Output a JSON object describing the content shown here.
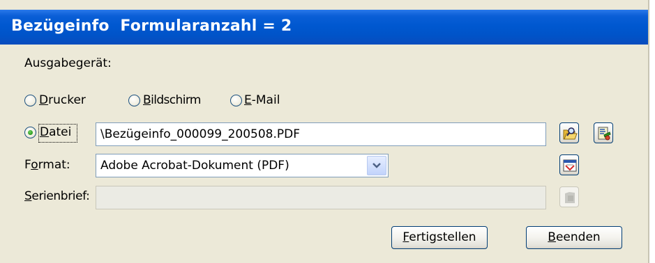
{
  "window": {
    "title": "Bezügeinfo  Formularanzahl = 2"
  },
  "output_device": {
    "label": "Ausgabegerät:",
    "options": [
      {
        "mnemonic": "D",
        "rest": "rucker",
        "selected": false
      },
      {
        "mnemonic": "B",
        "rest": "ildschirm",
        "selected": false
      },
      {
        "mnemonic": "E",
        "rest": "-Mail",
        "selected": false
      },
      {
        "mnemonic": "D",
        "rest": "atei",
        "selected": true
      }
    ]
  },
  "file": {
    "value": "\\Bezügeinfo_000099_200508.PDF",
    "browse_icon": "folder-search-icon",
    "edit_icon": "file-tools-icon"
  },
  "format": {
    "label_mnemonic": "o",
    "label_before": "F",
    "label_after": "rmat:",
    "value": "Adobe Acrobat-Dokument (PDF)",
    "options_icon": "format-properties-icon"
  },
  "serienbrief": {
    "label_mnemonic": "S",
    "label_rest": "erienbrief:",
    "value": "",
    "enabled": false,
    "icon": "template-icon"
  },
  "buttons": {
    "finish": {
      "mnemonic": "F",
      "rest": "ertigstellen"
    },
    "quit": {
      "mnemonic": "B",
      "rest": "eenden"
    }
  },
  "colors": {
    "titlebar": "#0058d0",
    "dialog_bg": "#ece9d8",
    "radio_selected": "#21a121"
  }
}
